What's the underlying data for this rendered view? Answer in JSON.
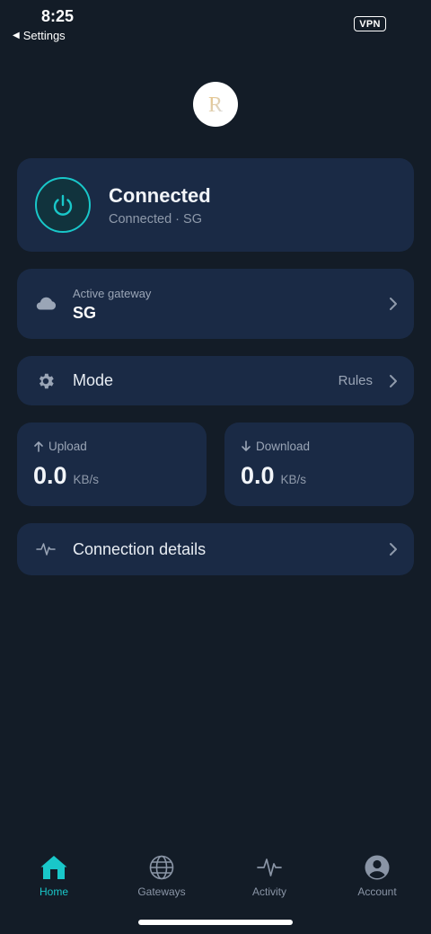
{
  "status_bar": {
    "time": "8:25",
    "back_label": "Settings",
    "vpn_badge": "VPN"
  },
  "logo": {
    "letter": "R"
  },
  "connection": {
    "title": "Connected",
    "subtitle": "Connected · SG",
    "icon": "power-icon",
    "accent_color": "#19c7c9"
  },
  "gateway": {
    "label": "Active gateway",
    "value": "SG",
    "icon": "cloud-icon"
  },
  "mode": {
    "label": "Mode",
    "value": "Rules",
    "icon": "gear-icon"
  },
  "stats": {
    "upload": {
      "label": "Upload",
      "value": "0.0",
      "unit": "KB/s",
      "icon": "arrow-up-icon"
    },
    "download": {
      "label": "Download",
      "value": "0.0",
      "unit": "KB/s",
      "icon": "arrow-down-icon"
    }
  },
  "details": {
    "label": "Connection details",
    "icon": "pulse-icon"
  },
  "tabs": [
    {
      "label": "Home",
      "icon": "home-icon",
      "active": true
    },
    {
      "label": "Gateways",
      "icon": "globe-icon",
      "active": false
    },
    {
      "label": "Activity",
      "icon": "pulse-icon",
      "active": false
    },
    {
      "label": "Account",
      "icon": "account-icon",
      "active": false
    }
  ],
  "colors": {
    "background": "#131c27",
    "card": "#1a2a45",
    "accent": "#19c7c9"
  }
}
